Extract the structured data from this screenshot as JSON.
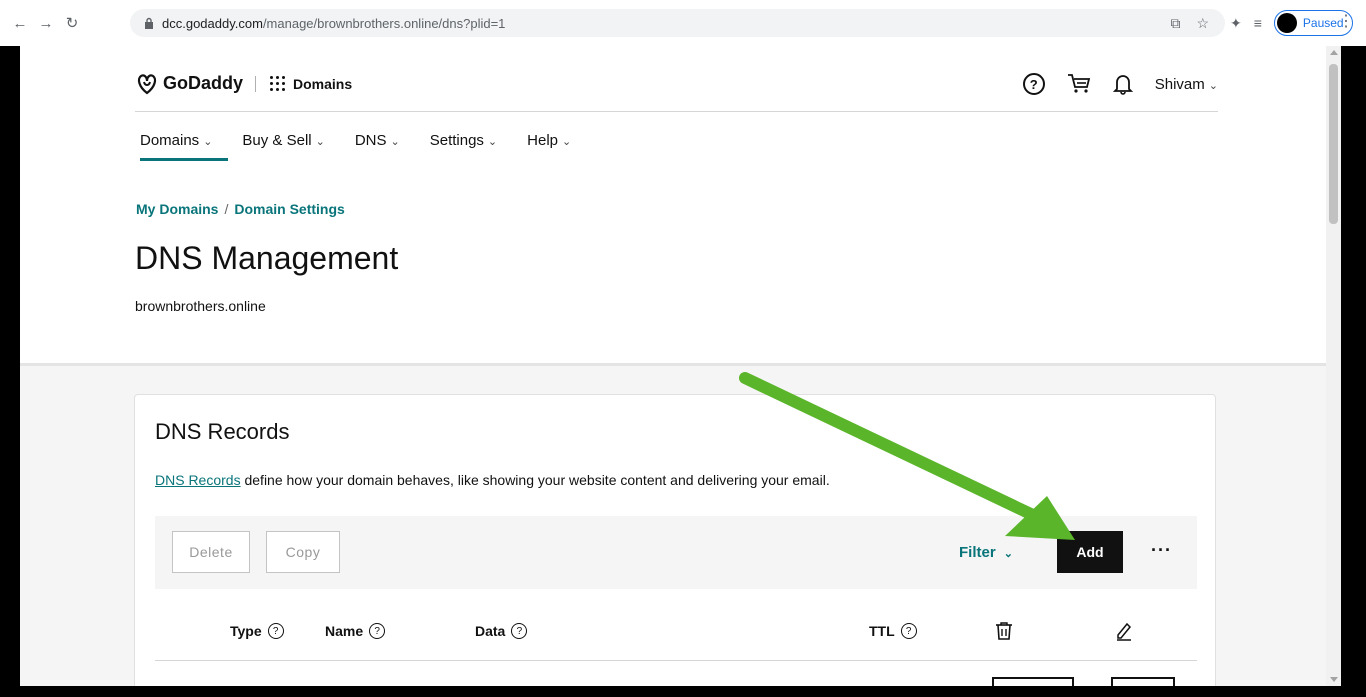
{
  "browser": {
    "url_host": "dcc.godaddy.com",
    "url_path": "/manage/brownbrothers.online/dns?plid=1",
    "profile_status": "Paused"
  },
  "header": {
    "logo_text": "GoDaddy",
    "product_label": "Domains",
    "help_symbol": "?",
    "user_name": "Shivam"
  },
  "nav": {
    "items": [
      {
        "label": "Domains"
      },
      {
        "label": "Buy & Sell"
      },
      {
        "label": "DNS"
      },
      {
        "label": "Settings"
      },
      {
        "label": "Help"
      }
    ]
  },
  "breadcrumb": {
    "items": [
      "My Domains",
      "Domain Settings"
    ],
    "separator": "/"
  },
  "page": {
    "title": "DNS Management",
    "domain": "brownbrothers.online"
  },
  "records": {
    "title": "DNS Records",
    "desc_link": "DNS Records",
    "desc_text": " define how your domain behaves, like showing your website content and delivering your email.",
    "delete_label": "Delete",
    "copy_label": "Copy",
    "filter_label": "Filter",
    "add_label": "Add",
    "more_label": "···",
    "columns": [
      {
        "label": "Type"
      },
      {
        "label": "Name"
      },
      {
        "label": "Data"
      },
      {
        "label": "TTL"
      }
    ]
  },
  "colors": {
    "accent": "#09757a",
    "annotation_arrow": "#5ab52a"
  }
}
